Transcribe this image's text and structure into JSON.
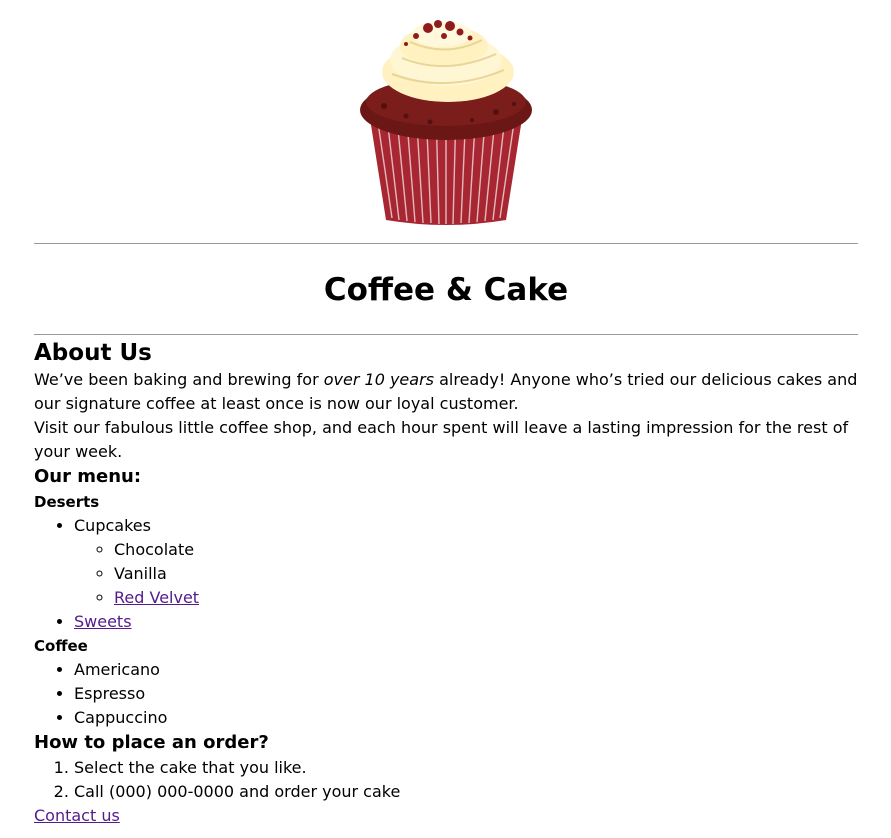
{
  "hero": {
    "image_name": "red-velvet-cupcake",
    "colors": {
      "frosting": "#fff3c4",
      "cake": "#6e1a18",
      "liner": "#b3303a"
    }
  },
  "header": {
    "title": "Coffee & Cake"
  },
  "about": {
    "heading": "About Us",
    "para1_before": "We’ve been baking and brewing for ",
    "para1_em": "over 10 years",
    "para1_after": " already! Anyone who’s tried our delicious cakes and our signature coffee at least once is now our loyal customer.",
    "para2": "Visit our fabulous little coffee shop, and each hour spent will leave a lasting impression for the rest of your week."
  },
  "menu": {
    "heading": "Our menu:",
    "deserts": {
      "heading": "Deserts",
      "cupcakes_label": "Cupcakes",
      "cupcake_flavors": [
        "Chocolate",
        "Vanilla"
      ],
      "red_velvet_link": "Red Velvet",
      "sweets_link": "Sweets"
    },
    "coffee": {
      "heading": "Coffee",
      "items": [
        "Americano",
        "Espresso",
        "Cappuccino"
      ]
    }
  },
  "order": {
    "heading": "How to place an order?",
    "steps": [
      "Select the cake that you like.",
      "Call (000) 000-0000 and order your cake"
    ]
  },
  "footer": {
    "contact_link": "Contact us"
  },
  "colors": {
    "link": "#551a8b",
    "rule": "#9a9a9a"
  }
}
